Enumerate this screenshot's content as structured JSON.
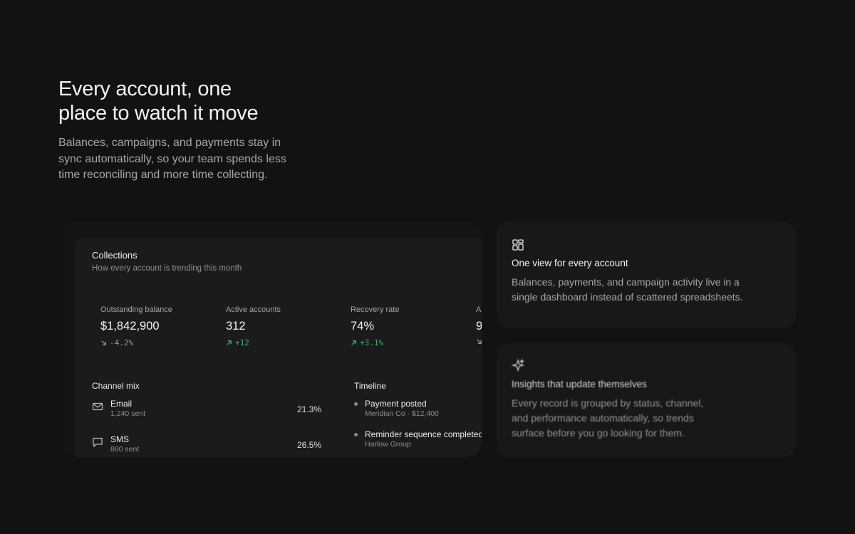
{
  "hero": {
    "title_lines": [
      "Every account, one",
      "place to watch it move"
    ],
    "subtitle_lines": [
      "Balances, campaigns, and payments stay in",
      "sync automatically, so your team spends less",
      "time reconciling and more time collecting."
    ]
  },
  "dashboard": {
    "title": "Collections",
    "subtitle": "How every account is trending this month",
    "stats": [
      {
        "label": "Outstanding balance",
        "value": "$1,842,900",
        "delta": "-4.2%",
        "direction": "down"
      },
      {
        "label": "Active accounts",
        "value": "312",
        "delta": "+12",
        "direction": "up"
      },
      {
        "label": "Recovery rate",
        "value": "74%",
        "delta": "+3.1%",
        "direction": "up"
      },
      {
        "label": "A",
        "value": "9",
        "delta": "",
        "direction": "down"
      }
    ],
    "channel_mix": {
      "title": "Channel mix",
      "items": [
        {
          "name": "Email",
          "sent": "1,240 sent",
          "percent": "21.3%",
          "icon": "mail-icon"
        },
        {
          "name": "SMS",
          "sent": "860 sent",
          "percent": "26.5%",
          "icon": "message-icon"
        }
      ]
    },
    "timeline": {
      "title": "Timeline",
      "items": [
        {
          "title": "Payment posted",
          "subtitle": "Meridian Co · $12,400"
        },
        {
          "title": "Reminder sequence completed",
          "subtitle": "Harlow Group"
        }
      ]
    }
  },
  "features": [
    {
      "icon": "grid-icon",
      "title": "One view for every account",
      "text_lines": [
        "Balances, payments, and campaign activity live in a",
        "single dashboard instead of scattered spreadsheets."
      ]
    },
    {
      "icon": "sparkle-icon",
      "title": "Insights that update themselves",
      "text_lines": [
        "Every record is grouped by status, channel,",
        "and performance automatically, so trends",
        "surface before you go looking for them."
      ]
    }
  ],
  "colors": {
    "background": "#121212",
    "panel": "#1b1b1b",
    "positive": "#3fb377",
    "muted": "#8f8f8f"
  }
}
